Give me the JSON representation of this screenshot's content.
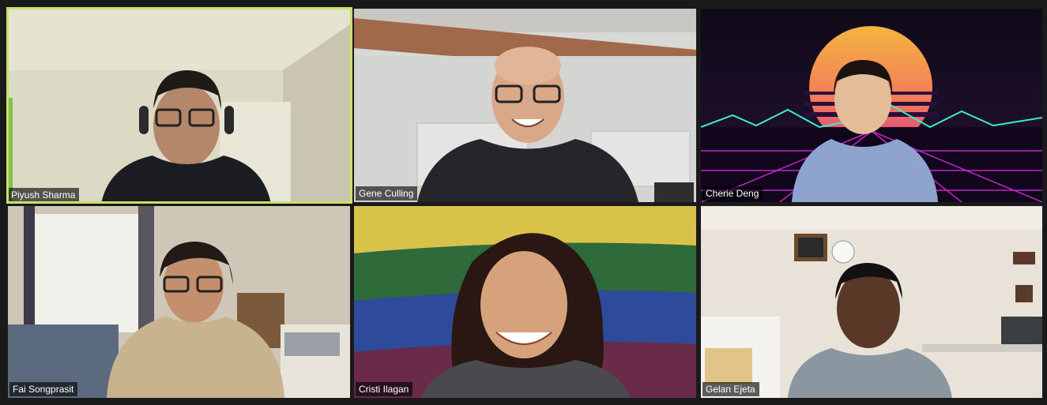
{
  "participants": [
    {
      "name": "Piyush Sharma",
      "active_speaker": true
    },
    {
      "name": "Gene Culling",
      "active_speaker": false
    },
    {
      "name": "Cherie Deng",
      "active_speaker": false
    },
    {
      "name": "Fai Songprasit",
      "active_speaker": false
    },
    {
      "name": "Cristi Ilagan",
      "active_speaker": false
    },
    {
      "name": "Gelan Ejeta",
      "active_speaker": false
    }
  ],
  "colors": {
    "background": "#1a1a1a",
    "speaker_highlight": "#c6e26a",
    "label_bg": "#000000"
  }
}
